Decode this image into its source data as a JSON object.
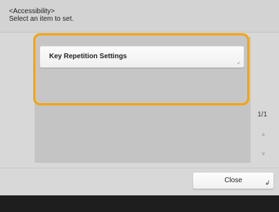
{
  "header": {
    "breadcrumb": "<Accessibility>",
    "instruction": "Select an item to set."
  },
  "list": {
    "items": [
      {
        "label": "Key Repetition Settings",
        "selected": true
      }
    ]
  },
  "pagination": {
    "indicator": "1/1"
  },
  "footer": {
    "close_label": "Close"
  },
  "colors": {
    "highlight": "#f6a300",
    "background": "#d8d8d8",
    "status_bar": "#1e1e1e"
  }
}
